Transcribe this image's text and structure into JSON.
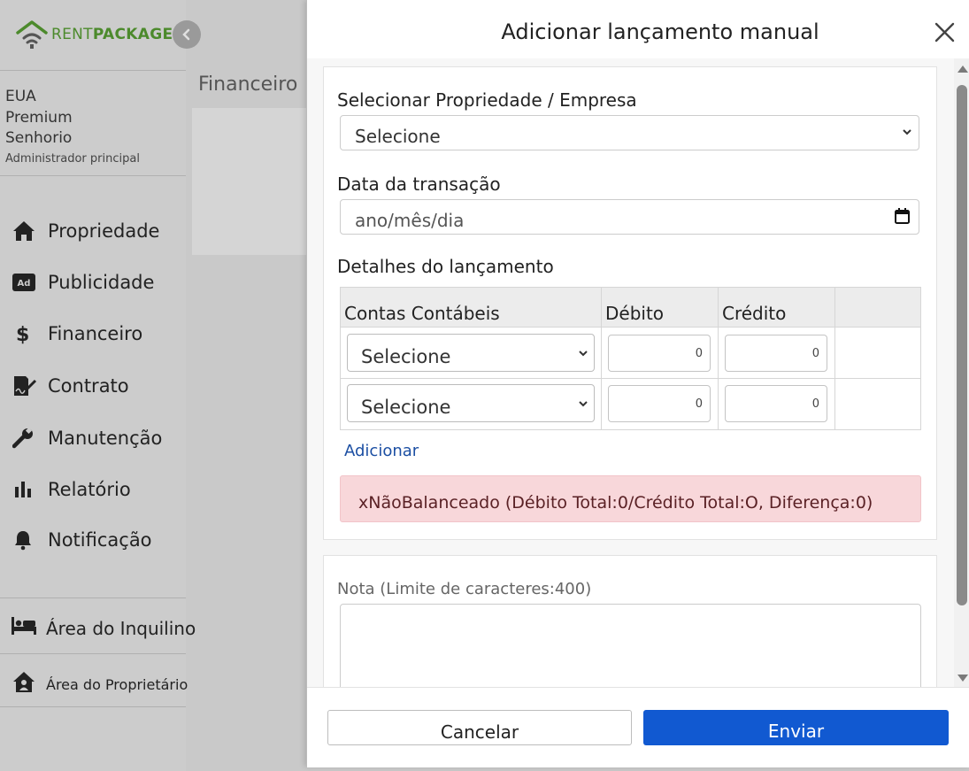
{
  "brand": {
    "rent": "RENT",
    "package": "PACKAGE",
    "accent": "#4c8a2c"
  },
  "sidebar": {
    "user": {
      "country": "EUA",
      "plan": "Premium",
      "type": "Senhorio",
      "role": "Administrador principal"
    },
    "items": [
      {
        "label": "Propriedade",
        "icon": "home-icon"
      },
      {
        "label": "Publicidade",
        "icon": "ad-icon"
      },
      {
        "label": "Financeiro",
        "icon": "dollar-icon"
      },
      {
        "label": "Contrato",
        "icon": "contract-icon"
      },
      {
        "label": "Manutenção",
        "icon": "wrench-icon"
      },
      {
        "label": "Relatório",
        "icon": "chart-icon"
      },
      {
        "label": "Notificação",
        "icon": "bell-icon"
      }
    ],
    "tenant_area": "Área do Inquilino",
    "owner_area": "Área do Proprietário"
  },
  "main": {
    "tab": "Financeiro"
  },
  "modal": {
    "title": "Adicionar lançamento manual",
    "property_label": "Selecionar Propriedade / Empresa",
    "property_value": "Selecione",
    "date_label": "Data da transação",
    "date_placeholder": "ano/mês/dia",
    "details_label": "Detalhes do lançamento",
    "table": {
      "headers": [
        "Contas Contábeis",
        "Débito",
        "Crédito",
        ""
      ],
      "rows": [
        {
          "account": "Selecione",
          "debit": "0",
          "credit": "0"
        },
        {
          "account": "Selecione",
          "debit": "0",
          "credit": "0"
        }
      ]
    },
    "add_link": "Adicionar",
    "alert": "xNãoBalanceado (Débito Total:0/Crédito Total:O, Diferença:0)",
    "note_label": "Nota (Limite de caracteres:400)",
    "cancel": "Cancelar",
    "submit": "Enviar",
    "colors": {
      "primary": "#1159d1",
      "alert_bg": "#f8d7da"
    }
  }
}
